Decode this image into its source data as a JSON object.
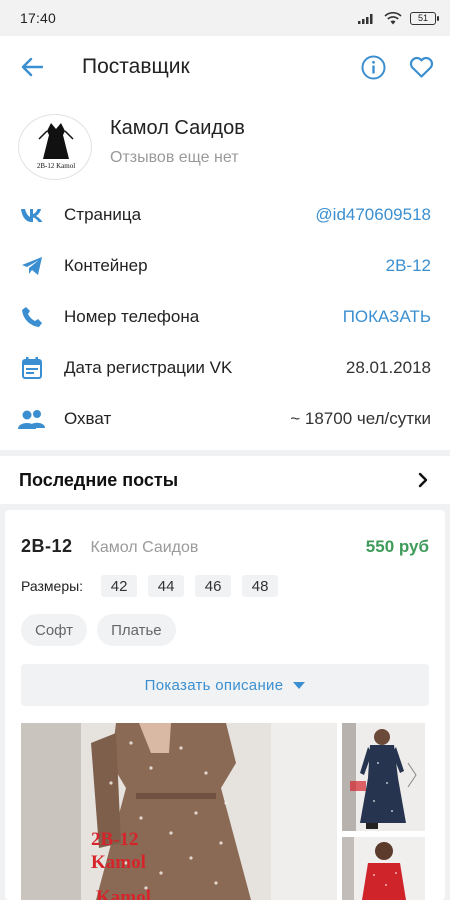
{
  "status_bar": {
    "time": "17:40",
    "battery": "51"
  },
  "app_bar": {
    "title": "Поставщик"
  },
  "profile": {
    "name": "Камол Саидов",
    "reviews": "Отзывов еще нет",
    "avatar_text": "2B-12 Kamol"
  },
  "info_rows": [
    {
      "icon": "vk-icon",
      "label": "Страница",
      "value": "@id470609518"
    },
    {
      "icon": "telegram-icon",
      "label": "Контейнер",
      "value": "2B-12"
    },
    {
      "icon": "phone-icon",
      "label": "Номер телефона",
      "value": "ПОКАЗАТЬ"
    },
    {
      "icon": "calendar-icon",
      "label": "Дата регистрации VK",
      "value": "28.01.2018"
    },
    {
      "icon": "people-icon",
      "label": "Охват",
      "value": "~ 18700 чел/сутки"
    }
  ],
  "recent_posts": {
    "title": "Последние посты"
  },
  "post": {
    "code": "2B-12",
    "author": "Камол Саидов",
    "price": "550 руб",
    "sizes_label": "Размеры:",
    "sizes": [
      "42",
      "44",
      "46",
      "48"
    ],
    "tags": [
      "Софт",
      "Платье"
    ],
    "show_description": "Показать описание",
    "photo_watermark_1": "2B-12",
    "photo_watermark_2": "Kamol",
    "photo_watermark_3": "Kamol"
  },
  "colors": {
    "accent": "#3b8fd0",
    "price": "#3f9b5a",
    "muted": "#9a9a9a"
  }
}
